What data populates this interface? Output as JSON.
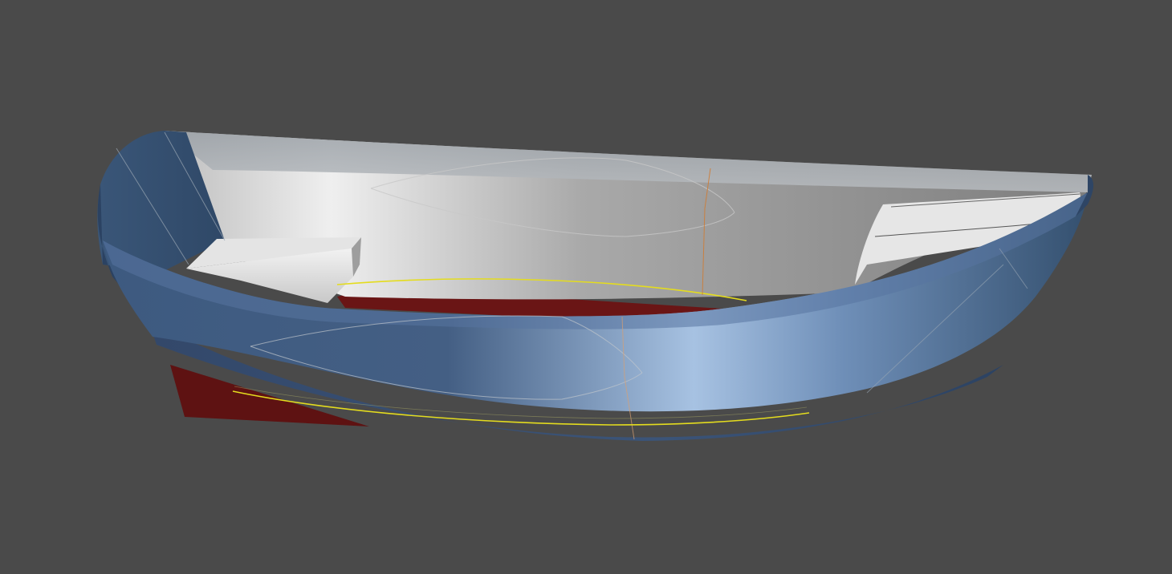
{
  "viewport": {
    "background_color": "#4a4a4a",
    "model": {
      "name": "",
      "colors": {
        "hull_exterior": "#3d5a7e",
        "hull_highlight": "#a8c4e4",
        "hull_dark": "#2a4060",
        "interior_light": "#e8e8e8",
        "interior_dark": "#7a7a7a",
        "keel_bottom": "#6a1414",
        "waterline": "#e8e020",
        "panel_lines": "#b0b0b0",
        "centerline": "#d07830"
      }
    }
  }
}
